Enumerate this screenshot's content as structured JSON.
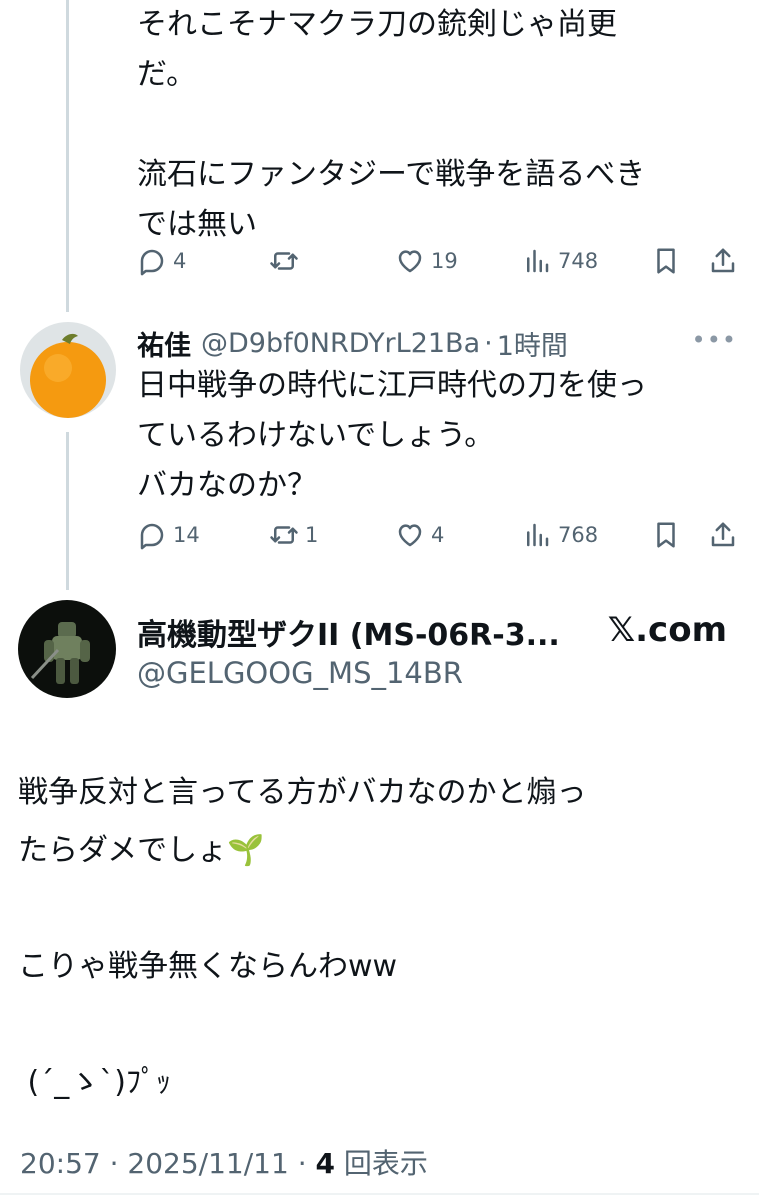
{
  "tweet1": {
    "text": "それこそナマクラ刀の銃剣じゃ尚更\nだ。\n\n流石にファンタジーで戦争を語るべき\nでは無い",
    "reply_count": "4",
    "retweet_count": "",
    "like_count": "19",
    "view_count": "748"
  },
  "tweet2": {
    "display_name": "祐佳",
    "handle": "@D9bf0NRDYrL21Ba",
    "separator": "·",
    "time": "1時間",
    "more": "•••",
    "text": "日中戦争の時代に江戸時代の刀を使っ\nているわけないでしょう。\nバカなのか？",
    "reply_count": "14",
    "retweet_count": "1",
    "like_count": "4",
    "view_count": "768"
  },
  "quote": {
    "display_name": "高機動型ザクII (MS-06R-3...",
    "handle": "@GELGOOG_MS_14BR",
    "source": "𝕏.com",
    "text": "戦争反対と言ってる方がバカなのかと煽っ\nたらダメでしょ🌱\n\nこりゃ戦争無くならんわww\n\n (´_ゝ`)ﾌﾟｯ"
  },
  "meta": {
    "time": "20:57",
    "sep1": " · ",
    "date": "2025/11/11",
    "sep2": " · ",
    "views_num": "4",
    "views_label": " 回表示"
  },
  "colors": {
    "text": "#0f1419",
    "secondary": "#536471",
    "thread_line": "#cfd9de",
    "avatar_orange": "#f59a10"
  },
  "icons": [
    "reply-icon",
    "retweet-icon",
    "like-icon",
    "views-icon",
    "bookmark-icon",
    "share-icon"
  ]
}
